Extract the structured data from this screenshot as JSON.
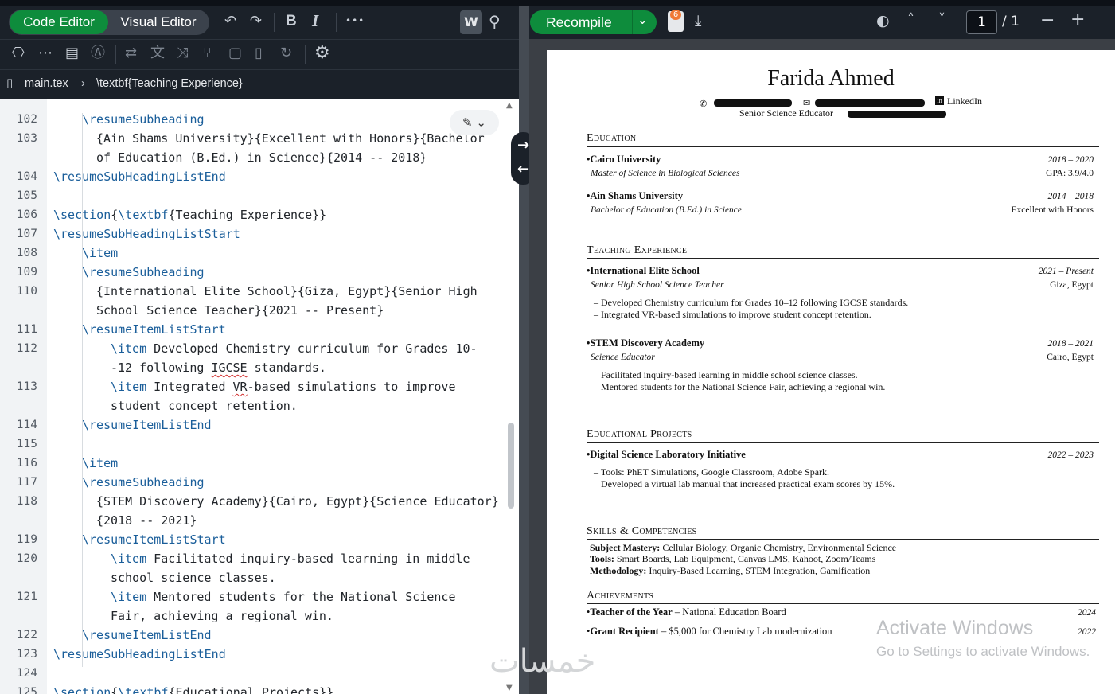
{
  "toolbar": {
    "code_editor": "Code Editor",
    "visual_editor": "Visual Editor",
    "bold": "B",
    "italic": "I",
    "more": "•••",
    "review": "W"
  },
  "breadcrumb": {
    "file": "main.tex",
    "section": "\\textbf{Teaching Experience}"
  },
  "code_lines": [
    {
      "num": "102",
      "text": "\\resumeSubheading"
    },
    {
      "num": "103",
      "text": "{Ain Shams University}{Excellent with Honors}{Bachelor"
    },
    {
      "num": "",
      "text": "of Education (B.Ed.) in Science}{2014 -- 2018}"
    },
    {
      "num": "104",
      "text": "\\resumeSubHeadingListEnd"
    },
    {
      "num": "105",
      "text": ""
    },
    {
      "num": "106",
      "text": "\\section{\\textbf{Teaching Experience}}"
    },
    {
      "num": "107",
      "text": "\\resumeSubHeadingListStart"
    },
    {
      "num": "108",
      "text": "\\item"
    },
    {
      "num": "109",
      "text": "\\resumeSubheading"
    },
    {
      "num": "110",
      "text": "{International Elite School}{Giza, Egypt}{Senior High"
    },
    {
      "num": "",
      "text": "School Science Teacher}{2021 -- Present}"
    },
    {
      "num": "111",
      "text": "\\resumeItemListStart"
    },
    {
      "num": "112",
      "text": "\\item Developed Chemistry curriculum for Grades 10-"
    },
    {
      "num": "",
      "text": "-12 following IGCSE standards."
    },
    {
      "num": "113",
      "text": "\\item Integrated VR-based simulations to improve"
    },
    {
      "num": "",
      "text": "student concept retention."
    },
    {
      "num": "114",
      "text": "\\resumeItemListEnd"
    },
    {
      "num": "115",
      "text": ""
    },
    {
      "num": "116",
      "text": "\\item"
    },
    {
      "num": "117",
      "text": "\\resumeSubheading"
    },
    {
      "num": "118",
      "text": "{STEM Discovery Academy}{Cairo, Egypt}{Science Educator}"
    },
    {
      "num": "",
      "text": "{2018 -- 2021}"
    },
    {
      "num": "119",
      "text": "\\resumeItemListStart"
    },
    {
      "num": "120",
      "text": "\\item Facilitated inquiry-based learning in middle"
    },
    {
      "num": "",
      "text": "school science classes."
    },
    {
      "num": "121",
      "text": "\\item Mentored students for the National Science"
    },
    {
      "num": "",
      "text": "Fair, achieving a regional win."
    },
    {
      "num": "122",
      "text": "\\resumeItemListEnd"
    },
    {
      "num": "123",
      "text": "\\resumeSubHeadingListEnd"
    },
    {
      "num": "124",
      "text": ""
    },
    {
      "num": "125",
      "text": "\\section{\\textbf{Educational Projects}}"
    }
  ],
  "preview_toolbar": {
    "recompile": "Recompile",
    "logs_count": "6",
    "page_current": "1",
    "page_total": "/ 1"
  },
  "resume": {
    "name": "Farida Ahmed",
    "linkedin": "LinkedIn",
    "tagline": "Senior Science Educator",
    "education_title": "Education",
    "edu": [
      {
        "school": "Cairo University",
        "dates": "2018 – 2020",
        "degree": "Master of Science in Biological Sciences",
        "right": "GPA: 3.9/4.0"
      },
      {
        "school": "Ain Shams University",
        "dates": "2014 – 2018",
        "degree": "Bachelor of Education (B.Ed.) in Science",
        "right": "Excellent with Honors"
      }
    ],
    "teaching_title": "Teaching Experience",
    "jobs": [
      {
        "org": "International Elite School",
        "dates": "2021 – Present",
        "role": "Senior High School Science Teacher",
        "loc": "Giza, Egypt",
        "b1": "– Developed Chemistry curriculum for Grades 10–12 following IGCSE standards.",
        "b2": "– Integrated VR-based simulations to improve student concept retention."
      },
      {
        "org": "STEM Discovery Academy",
        "dates": "2018 – 2021",
        "role": "Science Educator",
        "loc": "Cairo, Egypt",
        "b1": "– Facilitated inquiry-based learning in middle school science classes.",
        "b2": "– Mentored students for the National Science Fair, achieving a regional win."
      }
    ],
    "projects_title": "Educational Projects",
    "project": {
      "name": "Digital Science Laboratory Initiative",
      "dates": "2022 – 2023",
      "b1": "– Tools: PhET Simulations, Google Classroom, Adobe Spark.",
      "b2": "– Developed a virtual lab manual that increased practical exam scores by 15%."
    },
    "skills_title": "Skills & Competencies",
    "skills": [
      {
        "k": "Subject Mastery:",
        "v": " Cellular Biology, Organic Chemistry, Environmental Science"
      },
      {
        "k": "Tools:",
        "v": " Smart Boards, Lab Equipment, Canvas LMS, Kahoot, Zoom/Teams"
      },
      {
        "k": "Methodology:",
        "v": " Inquiry-Based Learning, STEM Integration, Gamification"
      }
    ],
    "achievements_title": "Achievements",
    "ach": [
      {
        "k": "Teacher of the Year",
        "v": " – National Education Board",
        "d": "2024"
      },
      {
        "k": "Grant Recipient",
        "v": " – $5,000 for Chemistry Lab modernization",
        "d": "2022"
      }
    ]
  },
  "watermark": {
    "line1": "Activate Windows",
    "line2": "Go to Settings to activate Windows.",
    "logo": "خمسات"
  }
}
